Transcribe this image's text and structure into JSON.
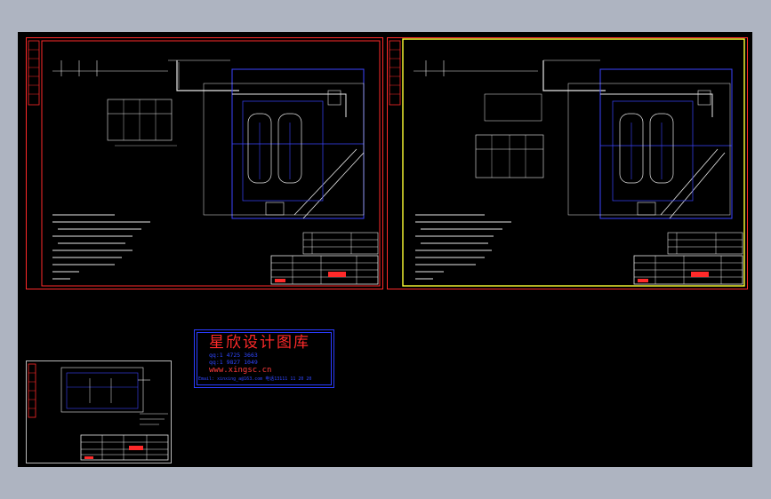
{
  "watermark": {
    "title": "星欣设计图库",
    "qq1": "qq:1 4725 3663",
    "qq2": "qq:1 9827 1049",
    "website": "www.xingsc.cn",
    "email": "Email: xinxing_a@163.com 电话13111 11 20 20"
  },
  "colors": {
    "background": "#aeb4c1",
    "canvas": "#000000",
    "frame_red": "#ff2a2a",
    "frame_yellow": "#ffff33",
    "line_blue": "#3b45ff",
    "line_white": "#e8e8e8"
  },
  "icons": [
    "dwg-sheet-1",
    "dwg-sheet-2",
    "dwg-sheet-small"
  ]
}
